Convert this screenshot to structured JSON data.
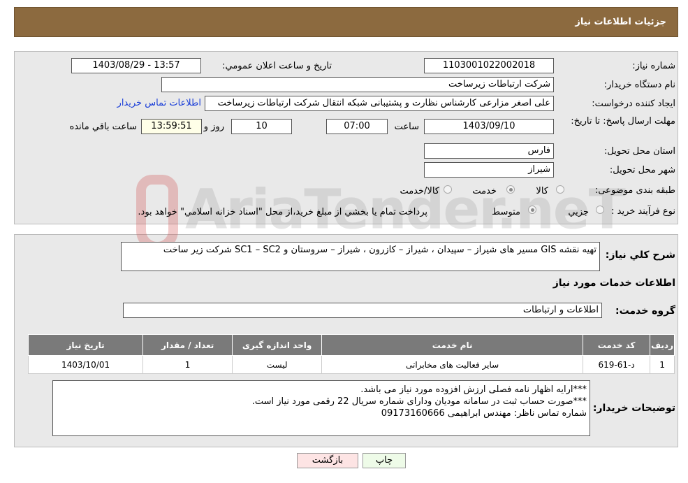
{
  "header": {
    "title": "جزئیات اطلاعات نیاز"
  },
  "form": {
    "need_number_label": "شماره نیاز:",
    "need_number": "1103001022002018",
    "announce_label": "تاریخ و ساعت اعلان عمومي:",
    "announce_value": "1403/08/29 - 13:57",
    "buyer_label": "نام دستگاه خريدار:",
    "buyer": "شرکت ارتباطات زیرساخت",
    "creator_label": "ايجاد کننده درخواست:",
    "creator": "علی اصغر مزارعی کارشناس نظارت و پشتیبانی شبکه انتقال شرکت ارتباطات زیرساخت",
    "contact_link": "اطلاعات تماس خريدار",
    "deadline_label": "مهلت ارسال پاسخ: تا تاریخ:",
    "deadline_date": "1403/09/10",
    "time_label": "ساعت",
    "deadline_time": "07:00",
    "days": "10",
    "days_label": "روز و",
    "remaining": "13:59:51",
    "remaining_label": "ساعت باقي مانده",
    "province_label": "استان محل تحويل:",
    "province": "فارس",
    "city_label": "شهر محل تحويل:",
    "city": "شیراز",
    "category_label": "طبقه بندی موضوعی:",
    "category_options": [
      "کالا",
      "خدمت",
      "کالا/خدمت"
    ],
    "category_selected": "خدمت",
    "process_label": "نوع فرآيند خريد :",
    "process_options": [
      "جزيي",
      "متوسط"
    ],
    "process_selected": "متوسط",
    "process_note": "پرداخت تمام يا بخشي از مبلغ خريد،از محل \"اسناد خزانه اسلامي\" خواهد بود."
  },
  "summary": {
    "label": "شرح كلي نياز:",
    "text": "تهیه نقشه GIS  مسیر های شیراز – سپیدان ، شیراز – کازرون ، شیراز – سروستان و SC1 – SC2  شرکت زیر ساخت"
  },
  "services": {
    "title": "اطلاعات خدمات مورد نياز",
    "group_label": "گروه خدمت:",
    "group": "اطلاعات و ارتباطات",
    "columns": [
      "رديف",
      "کد خدمت",
      "نام خدمت",
      "واحد اندازه گيری",
      "تعداد / مقدار",
      "تاريخ نياز"
    ],
    "rows": [
      [
        "1",
        "د-61-619",
        "سایر فعالیت های مخابراتی",
        "لیست",
        "1",
        "1403/10/01"
      ]
    ]
  },
  "notes": {
    "label": "توضيحات خريدار:",
    "lines": [
      "***ارایه اظهار نامه فصلی ارزش افزوده مورد نیاز می باشد.",
      "***صورت حساب ثبت در سامانه مودیان ودارای شماره سریال 22 رقمی مورد نیاز است.",
      "شماره تماس ناظر: مهندس ابراهیمی 09173160666"
    ]
  },
  "buttons": {
    "print": "چاپ",
    "back": "بازگشت"
  },
  "watermark": "AriaTender.neT"
}
